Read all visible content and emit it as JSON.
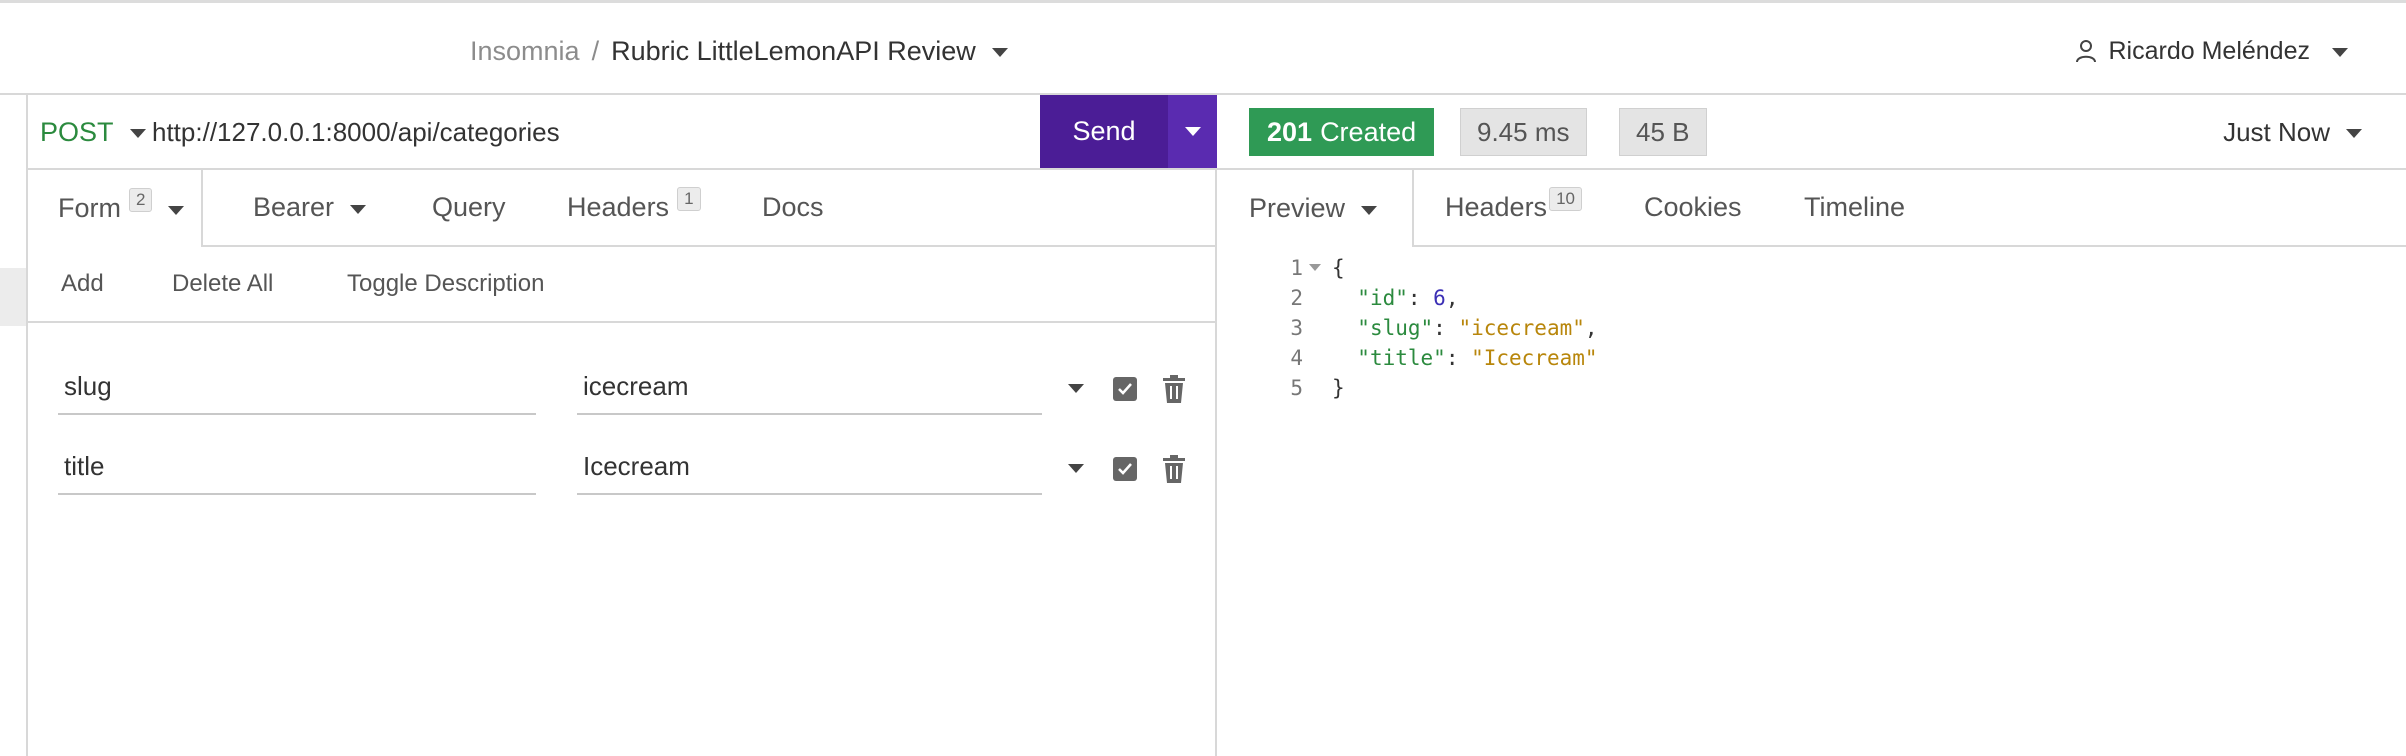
{
  "header": {
    "root_label": "Insomnia",
    "separator": "/",
    "workspace_title": "Rubric LittleLemonAPI Review",
    "user_name": "Ricardo Meléndez"
  },
  "request": {
    "method": "POST",
    "url": "http://127.0.0.1:8000/api/categories",
    "send_label": "Send",
    "tabs": [
      {
        "label": "Form",
        "badge": "2",
        "active": true
      },
      {
        "label": "Bearer",
        "active": false
      },
      {
        "label": "Query",
        "active": false
      },
      {
        "label": "Headers",
        "badge": "1",
        "active": false
      },
      {
        "label": "Docs",
        "active": false
      }
    ],
    "form_actions": {
      "add": "Add",
      "delete_all": "Delete All",
      "toggle_description": "Toggle Description"
    },
    "params": [
      {
        "name": "slug",
        "value": "icecream",
        "enabled": true
      },
      {
        "name": "title",
        "value": "Icecream",
        "enabled": true
      }
    ]
  },
  "response": {
    "status_code": "201",
    "status_text": "Created",
    "time": "9.45 ms",
    "size": "45 B",
    "timestamp_label": "Just Now",
    "tabs": [
      {
        "label": "Preview",
        "active": true
      },
      {
        "label": "Headers",
        "badge": "10",
        "active": false
      },
      {
        "label": "Cookies",
        "active": false
      },
      {
        "label": "Timeline",
        "active": false
      }
    ],
    "body_lines": [
      {
        "no": "1",
        "open": "{"
      },
      {
        "no": "2",
        "key": "\"id\"",
        "value": "6",
        "type": "num",
        "comma": ","
      },
      {
        "no": "3",
        "key": "\"slug\"",
        "value": "\"icecream\"",
        "type": "str",
        "comma": ","
      },
      {
        "no": "4",
        "key": "\"title\"",
        "value": "\"Icecream\"",
        "type": "str",
        "comma": ""
      },
      {
        "no": "5",
        "close": "}"
      }
    ]
  },
  "colors": {
    "method_post": "#2b8a3e",
    "send_button": "#4b1d96",
    "status_success": "#2f9a55",
    "json_key": "#2b8a3e",
    "json_number": "#3b2fb5",
    "json_string": "#b8860b"
  },
  "icons": {
    "user": "user-icon",
    "caret": "chevron-down-icon",
    "checkbox": "checkbox-checked-icon",
    "trash": "trash-icon",
    "fold": "fold-arrow-icon"
  }
}
